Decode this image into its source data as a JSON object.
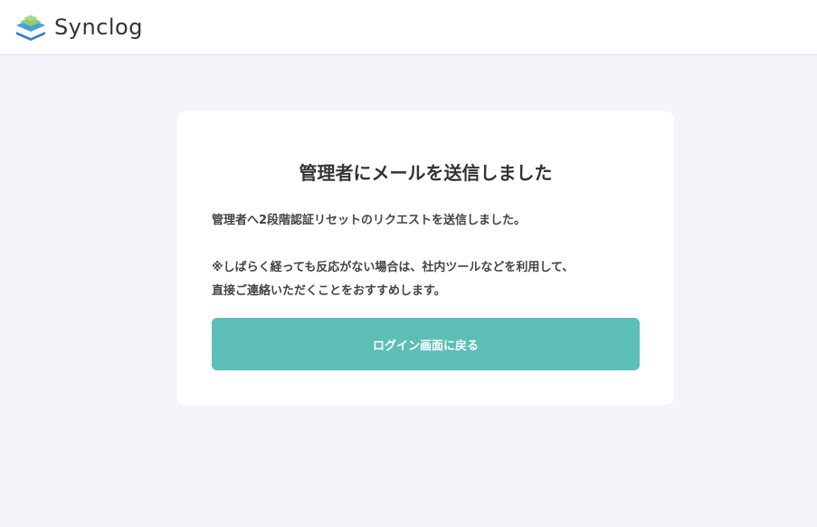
{
  "header": {
    "brand_name": "Synclog",
    "logo_icon": "synclog-stack-logo",
    "colors": {
      "logo_green": "#8ccf6a",
      "logo_blue": "#3a7fcf"
    }
  },
  "card": {
    "title": "管理者にメールを送信しました",
    "message_line1": "管理者へ2段階認証リセットのリクエストを送信しました。",
    "message_line2": "※しばらく経っても反応がない場合は、社内ツールなどを利用して、",
    "message_line3": "直接ご連絡いただくことをおすすめします。",
    "button_label": "ログイン画面に戻る",
    "button_color": "#5cbeb7"
  }
}
